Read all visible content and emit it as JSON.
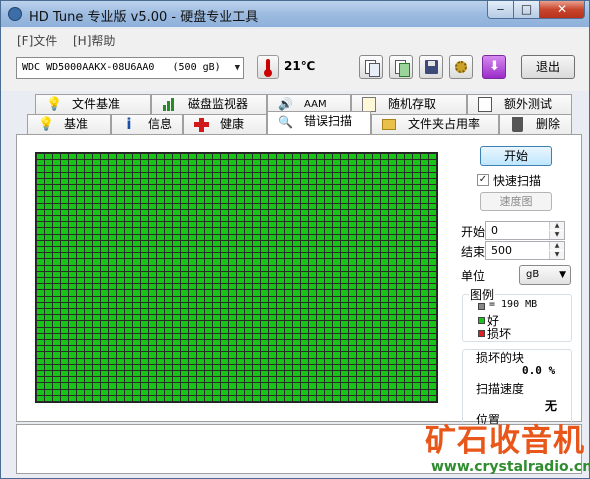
{
  "window": {
    "title": "HD Tune 专业版 v5.00 - 硬盘专业工具"
  },
  "menu": {
    "file": "[F]文件",
    "help": "[H]帮助"
  },
  "toolbar": {
    "drive": "WDC WD5000AAKX-08U6AA0   (500 gB)",
    "temperature": "21℃",
    "exit_label": "退出"
  },
  "tabs_top": [
    "文件基准",
    "磁盘监视器",
    "AAM",
    "随机存取",
    "额外测试"
  ],
  "tabs_bottom": [
    "基准",
    "信息",
    "健康",
    "错误扫描",
    "文件夹占用率",
    "删除"
  ],
  "active_tab": "错误扫描",
  "scan": {
    "start_button": "开始",
    "quick_scan_label": "快速扫描",
    "quick_scan_checked": true,
    "speed_map_button": "速度图",
    "start_label": "开始",
    "start_value": "0",
    "end_label": "结束",
    "end_value": "500",
    "unit_label": "单位",
    "unit_value": "gB",
    "grid_status": "good"
  },
  "legend": {
    "title": "图例",
    "block_size": "= 190 MB",
    "good": "好",
    "damaged": "损坏",
    "colors": {
      "block": "#888888",
      "good": "#19c419",
      "damaged": "#e02020"
    }
  },
  "results": {
    "damaged_blocks_label": "损坏的块",
    "damaged_blocks_value": "0.0 %",
    "scan_speed_label": "扫描速度",
    "scan_speed_value": "无",
    "position_label": "位置"
  },
  "watermark": {
    "title": "矿石收音机",
    "url": "www.crystalradio.cn"
  }
}
